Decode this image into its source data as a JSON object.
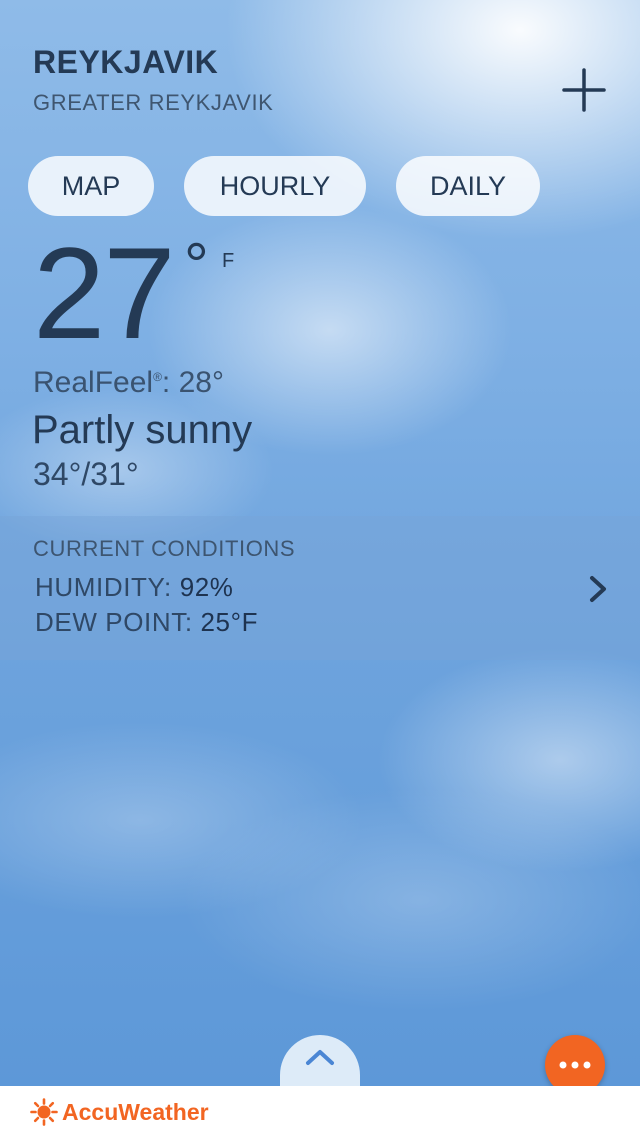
{
  "location": {
    "city": "REYKJAVIK",
    "region": "GREATER REYKJAVIK"
  },
  "icons": {
    "add": "plus-icon",
    "chevron": "chevron-right-icon",
    "pull_up": "chevron-up-icon",
    "more": "ellipsis-icon",
    "brand": "sun-logo-icon"
  },
  "tabs": [
    {
      "label": "MAP"
    },
    {
      "label": "HOURLY"
    },
    {
      "label": "DAILY"
    }
  ],
  "current": {
    "temperature": "27",
    "degree": "°",
    "unit": "F",
    "realfeel_label": "RealFeel",
    "realfeel_mark": "®",
    "realfeel_value": ": 28°",
    "condition": "Partly sunny",
    "hi_lo": "34°/31°"
  },
  "conditions": {
    "title": "CURRENT CONDITIONS",
    "humidity_label": "HUMIDITY:",
    "humidity_value": "92%",
    "dew_point_label": "DEW POINT:",
    "dew_point_value": "25°F"
  },
  "footer": {
    "brand": "AccuWeather"
  },
  "colors": {
    "accent": "#f26522",
    "text_primary": "#243a55"
  }
}
